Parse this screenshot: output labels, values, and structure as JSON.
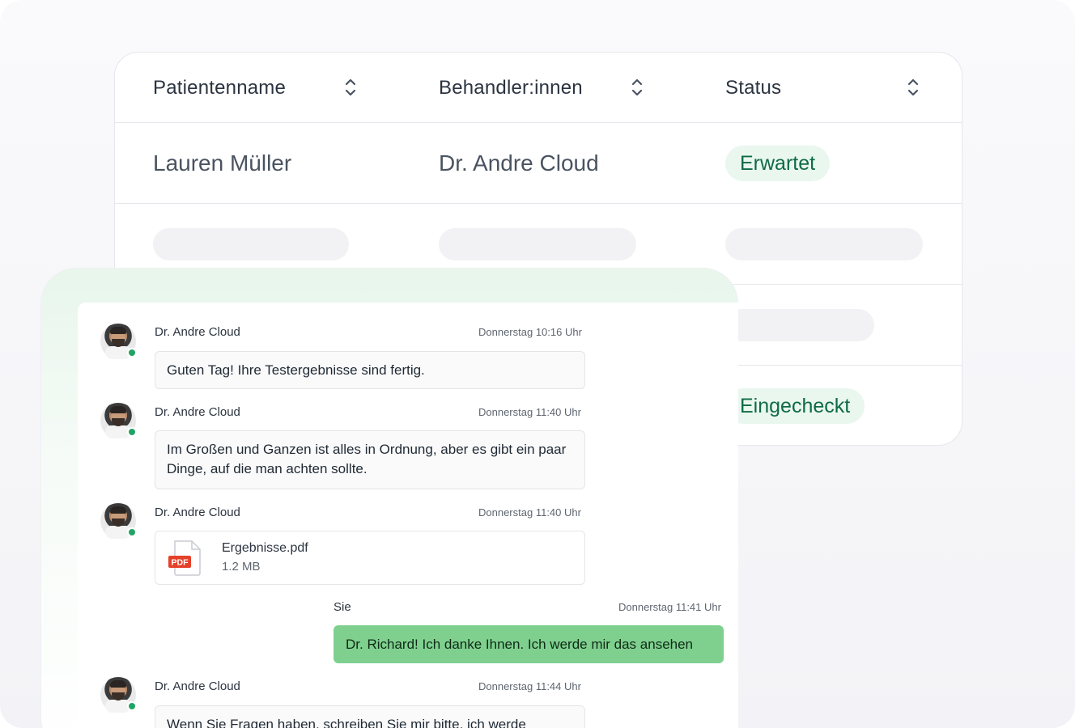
{
  "table": {
    "columns": [
      {
        "label": "Patientenname"
      },
      {
        "label": "Behandler:innen"
      },
      {
        "label": "Status"
      }
    ],
    "rows": [
      {
        "patient": "Lauren Müller",
        "practitioner": "Dr. Andre Cloud",
        "status": "Erwartet"
      },
      {
        "status": "Eingecheckt"
      }
    ],
    "status_colors": {
      "badge_bg": "#e9f7ef",
      "badge_text": "#0f6b43"
    }
  },
  "chat": {
    "messages": [
      {
        "sender": "Dr. Andre Cloud",
        "time": "Donnerstag 10:16 Uhr",
        "text": "Guten Tag! Ihre Testergebnisse sind fertig."
      },
      {
        "sender": "Dr. Andre Cloud",
        "time": "Donnerstag 11:40 Uhr",
        "text": "Im Großen und Ganzen ist alles in Ordnung, aber es gibt ein paar Dinge, auf die man achten sollte."
      },
      {
        "sender": "Dr. Andre Cloud",
        "time": "Donnerstag 11:40 Uhr",
        "file": {
          "badge": "PDF",
          "name": "Ergebnisse.pdf",
          "size": "1.2 MB"
        }
      },
      {
        "sender": "Sie",
        "time": "Donnerstag 11:41 Uhr",
        "text": "Dr. Richard! Ich danke Ihnen. Ich werde mir das ansehen"
      },
      {
        "sender": "Dr. Andre Cloud",
        "time": "Donnerstag 11:44 Uhr",
        "text": "Wenn Sie Fragen haben, schreiben Sie mir bitte, ich werde"
      }
    ],
    "colors": {
      "own_bubble": "#7fd08f",
      "online_dot": "#20a464",
      "pdf_badge": "#e5402a"
    },
    "icons": {
      "sort": "sort-updown-icon",
      "file": "pdf-file-icon"
    }
  }
}
